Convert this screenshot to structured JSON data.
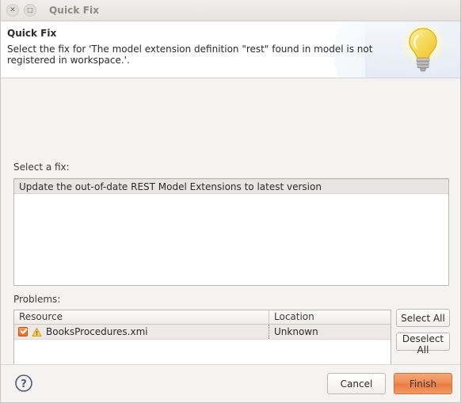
{
  "window": {
    "title": "Quick Fix",
    "close_icon": "close-icon",
    "maximize_icon": "maximize-icon"
  },
  "banner": {
    "title": "Quick Fix",
    "subtitle": "Select the fix for 'The model extension definition \"rest\" found in model is not registered in workspace.'.",
    "icon": "lightbulb-icon"
  },
  "fix_section": {
    "label": "Select a fix:",
    "items": [
      {
        "label": "Update the out-of-date REST Model Extensions to latest version",
        "selected": true
      }
    ]
  },
  "problems_section": {
    "label": "Problems:",
    "columns": [
      "Resource",
      "Location"
    ],
    "rows": [
      {
        "checked": true,
        "severity_icon": "warning-icon",
        "resource": "BooksProcedures.xmi",
        "location": "Unknown"
      }
    ],
    "select_all_label": "Select All",
    "deselect_all_label": "Deselect All"
  },
  "footer": {
    "help_icon": "help-icon",
    "cancel_label": "Cancel",
    "finish_label": "Finish"
  },
  "colors": {
    "accent_orange": "#ea7b41",
    "checkbox_orange": "#e8701f",
    "warning_yellow": "#f5c342",
    "dialog_background": "#f4f3f1",
    "field_background": "#ffffff"
  }
}
